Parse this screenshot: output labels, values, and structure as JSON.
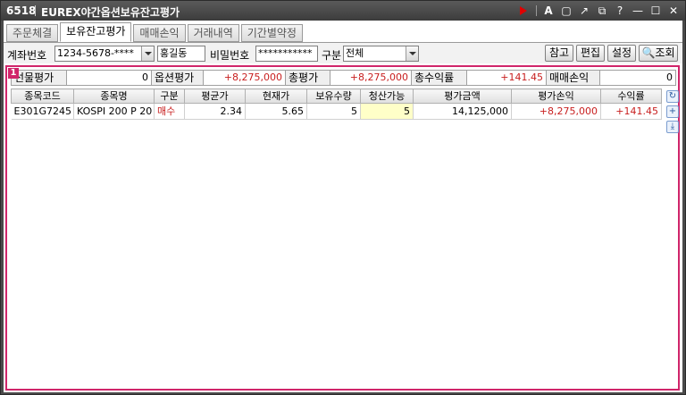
{
  "window": {
    "screen_number": "6518",
    "title": "EUREX야간옵션보유잔고평가"
  },
  "tabs": [
    {
      "label": "주문체결"
    },
    {
      "label": "보유잔고평가"
    },
    {
      "label": "매매손익"
    },
    {
      "label": "거래내역"
    },
    {
      "label": "기간별약정"
    }
  ],
  "toolbar": {
    "account_label": "계좌번호",
    "account_value": "1234-5678-****",
    "owner_name": "홍길동",
    "password_label": "비밀번호",
    "password_value": "***********",
    "category_label": "구분",
    "category_value": "전체",
    "btn_reference": "참고",
    "btn_edit": "편집",
    "btn_settings": "설정",
    "btn_query": "조회"
  },
  "panel_badge": "1",
  "summary": {
    "futures_eval_label": "선물평가",
    "futures_eval_value": "0",
    "options_eval_label": "옵션평가",
    "options_eval_value": "+8,275,000",
    "total_eval_label": "총평가",
    "total_eval_value": "+8,275,000",
    "total_return_label": "총수익률",
    "total_return_value": "+141.45",
    "trade_pnl_label": "매매손익",
    "trade_pnl_value": "0"
  },
  "grid": {
    "columns": [
      "종목코드",
      "종목명",
      "구분",
      "평균가",
      "현재가",
      "보유수량",
      "청산가능",
      "평가금액",
      "평가손익",
      "수익률"
    ],
    "rows": [
      {
        "code": "E301G7245",
        "name": "KOSPI 200 P 20",
        "side": "매수",
        "avg_price": "2.34",
        "cur_price": "5.65",
        "qty": "5",
        "closable": "5",
        "eval_amount": "14,125,000",
        "eval_pnl": "+8,275,000",
        "return": "+141.45"
      }
    ]
  },
  "colors": {
    "accent": "#d0256a",
    "positive": "#c81e1e",
    "highlight_cell": "#ffffc8"
  }
}
